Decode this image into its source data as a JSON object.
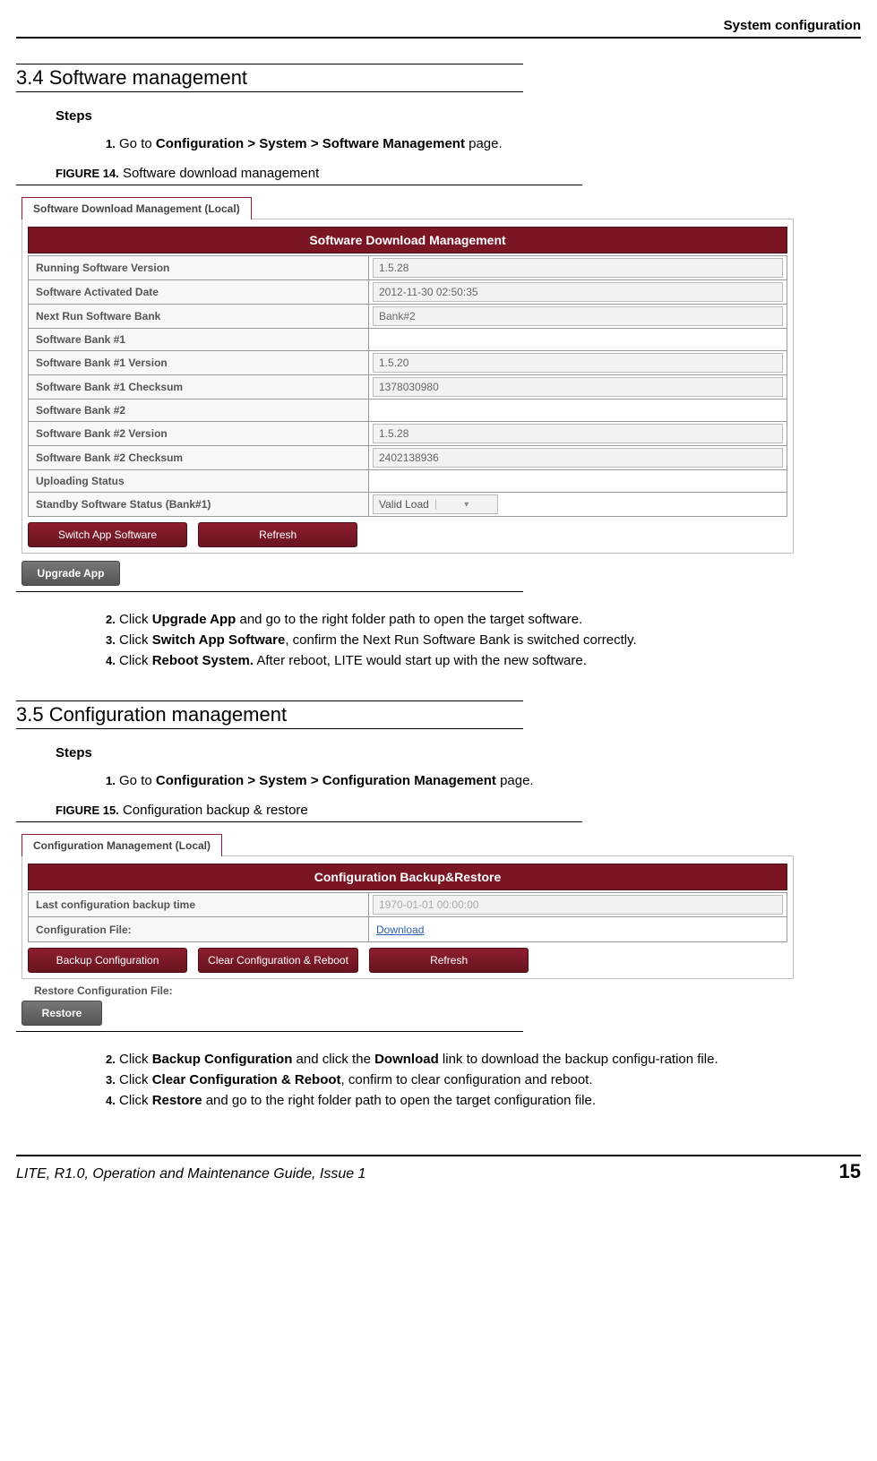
{
  "header_right": "System configuration",
  "sec34": {
    "title": "3.4 Software management",
    "steps_label": "Steps",
    "step1_pre": "1.",
    "step1_a": " Go to ",
    "step1_b": "Configuration > System > Software Management",
    "step1_c": " page.",
    "fig_label": "FIGURE 14.",
    "fig_caption": " Software download management",
    "tab": "Software Download Management (Local)",
    "panel_title": "Software Download Management",
    "rows": [
      {
        "label": "Running Software Version",
        "value": "1.5.28",
        "input": true
      },
      {
        "label": "Software Activated Date",
        "value": "2012-11-30 02:50:35",
        "input": true
      },
      {
        "label": "Next Run Software Bank",
        "value": "Bank#2",
        "input": true
      },
      {
        "label": "Software Bank #1",
        "value": "",
        "input": false
      },
      {
        "label": "Software Bank #1 Version",
        "value": "1.5.20",
        "input": true
      },
      {
        "label": "Software Bank #1 Checksum",
        "value": "1378030980",
        "input": true
      },
      {
        "label": "Software Bank #2",
        "value": "",
        "input": false
      },
      {
        "label": "Software Bank #2 Version",
        "value": "1.5.28",
        "input": true
      },
      {
        "label": "Software Bank #2 Checksum",
        "value": "2402138936",
        "input": true
      },
      {
        "label": "Uploading Status",
        "value": "",
        "input": false
      },
      {
        "label": "Standby Software Status (Bank#1)",
        "value": "Valid Load",
        "dropdown": true
      }
    ],
    "btn_switch": "Switch App Software",
    "btn_refresh": "Refresh",
    "btn_upgrade": "Upgrade App",
    "step2_n": "2.",
    "step2_a": " Click ",
    "step2_b": "Upgrade App",
    "step2_c": " and go to the right folder path to open the target software.",
    "step3_n": "3.",
    "step3_a": " Click ",
    "step3_b": "Switch App Software",
    "step3_c": ", confirm the Next Run Software Bank is switched correctly.",
    "step4_n": "4.",
    "step4_a": " Click ",
    "step4_b": "Reboot System.",
    "step4_c": " After reboot, LITE would start up with the new software."
  },
  "sec35": {
    "title": "3.5 Configuration management",
    "steps_label": "Steps",
    "step1_pre": "1.",
    "step1_a": " Go to ",
    "step1_b": "Configuration > System > Configuration Management",
    "step1_c": " page.",
    "fig_label": "FIGURE 15.",
    "fig_caption": " Configuration backup & restore",
    "tab": "Configuration Management (Local)",
    "panel_title": "Configuration Backup&Restore",
    "row_backup_label": "Last configuration backup time",
    "row_backup_value": "1970-01-01 00:00:00",
    "row_file_label": "Configuration File:",
    "row_file_link": "Download",
    "btn_backup": "Backup Configuration",
    "btn_clear": "Clear Configuration & Reboot",
    "btn_refresh": "Refresh",
    "restore_label": "Restore Configuration File:",
    "btn_restore": "Restore",
    "step2_n": "2.",
    "step2_a": " Click ",
    "step2_b": "Backup Configuration",
    "step2_c": " and click the ",
    "step2_d": "Download",
    "step2_e": " link to download the backup configu-ration file.",
    "step3_n": "3.",
    "step3_a": " Click ",
    "step3_b": "Clear Configuration & Reboot",
    "step3_c": ", confirm to clear configuration and reboot.",
    "step4_n": "4.",
    "step4_a": " Click ",
    "step4_b": "Restore",
    "step4_c": " and go to the right folder path to open the target configuration file."
  },
  "footer_left": "LITE, R1.0, Operation and Maintenance Guide, Issue 1",
  "footer_right": "15"
}
